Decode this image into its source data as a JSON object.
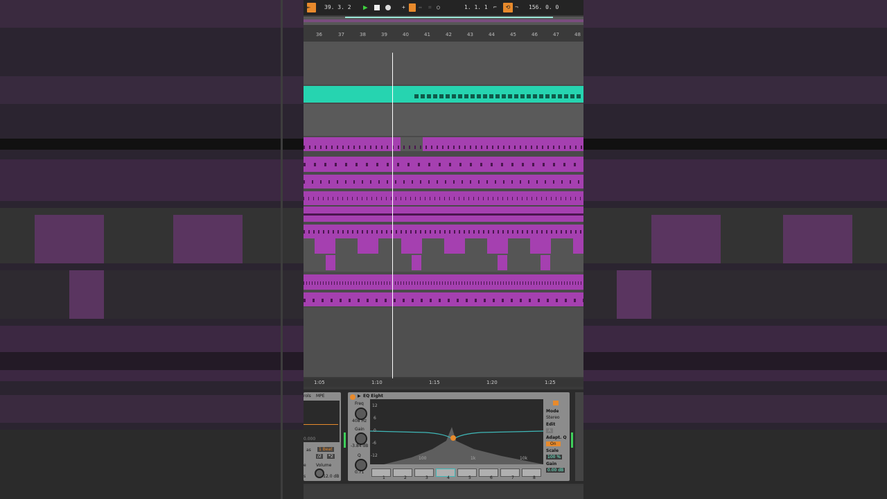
{
  "transport": {
    "position": "39. 3. 2",
    "loop_start": "1. 1. 1",
    "loop_length": "156. 0. 0"
  },
  "ruler": {
    "bars": [
      "36",
      "37",
      "38",
      "39",
      "40",
      "41",
      "42",
      "43",
      "44",
      "45",
      "46",
      "47",
      "48"
    ]
  },
  "timeline": {
    "times": [
      "1:05",
      "1:10",
      "1:15",
      "1:20",
      "1:25"
    ]
  },
  "left_device": {
    "title": "rols",
    "mpe": "MPE",
    "value": "0.000",
    "as_label": "as",
    "beat": "1 Beat",
    "half": "/2",
    "double": "*2",
    "e_label": "e",
    "volume_label": "Volume",
    "s_label": "s",
    "volume_value": "-12.0 dB"
  },
  "eq": {
    "title": "EQ Eight",
    "freq_label": "Freq",
    "freq_value": "408 Hz",
    "gain_label": "Gain",
    "gain_value": "-3.84 dB",
    "q_label": "Q",
    "q_value": "0.71",
    "db_scale": [
      "12",
      "6",
      "0",
      "-6",
      "-12"
    ],
    "freq_scale": [
      "100",
      "1k",
      "10k"
    ],
    "bands": [
      "1",
      "2",
      "3",
      "4",
      "5",
      "6",
      "7",
      "8"
    ],
    "mode_label": "Mode",
    "mode_value": "Stereo",
    "edit_label": "Edit",
    "edit_value": "A",
    "adapt_label": "Adapt. Q",
    "adapt_value": "On",
    "scale_label": "Scale",
    "scale_value": "100 %",
    "gain_out_label": "Gain",
    "gain_out_value": "0.00 dB"
  },
  "colors": {
    "clip_purple": "#a540b0",
    "clip_teal": "#26d4b0",
    "accent_orange": "#e88a2c"
  }
}
